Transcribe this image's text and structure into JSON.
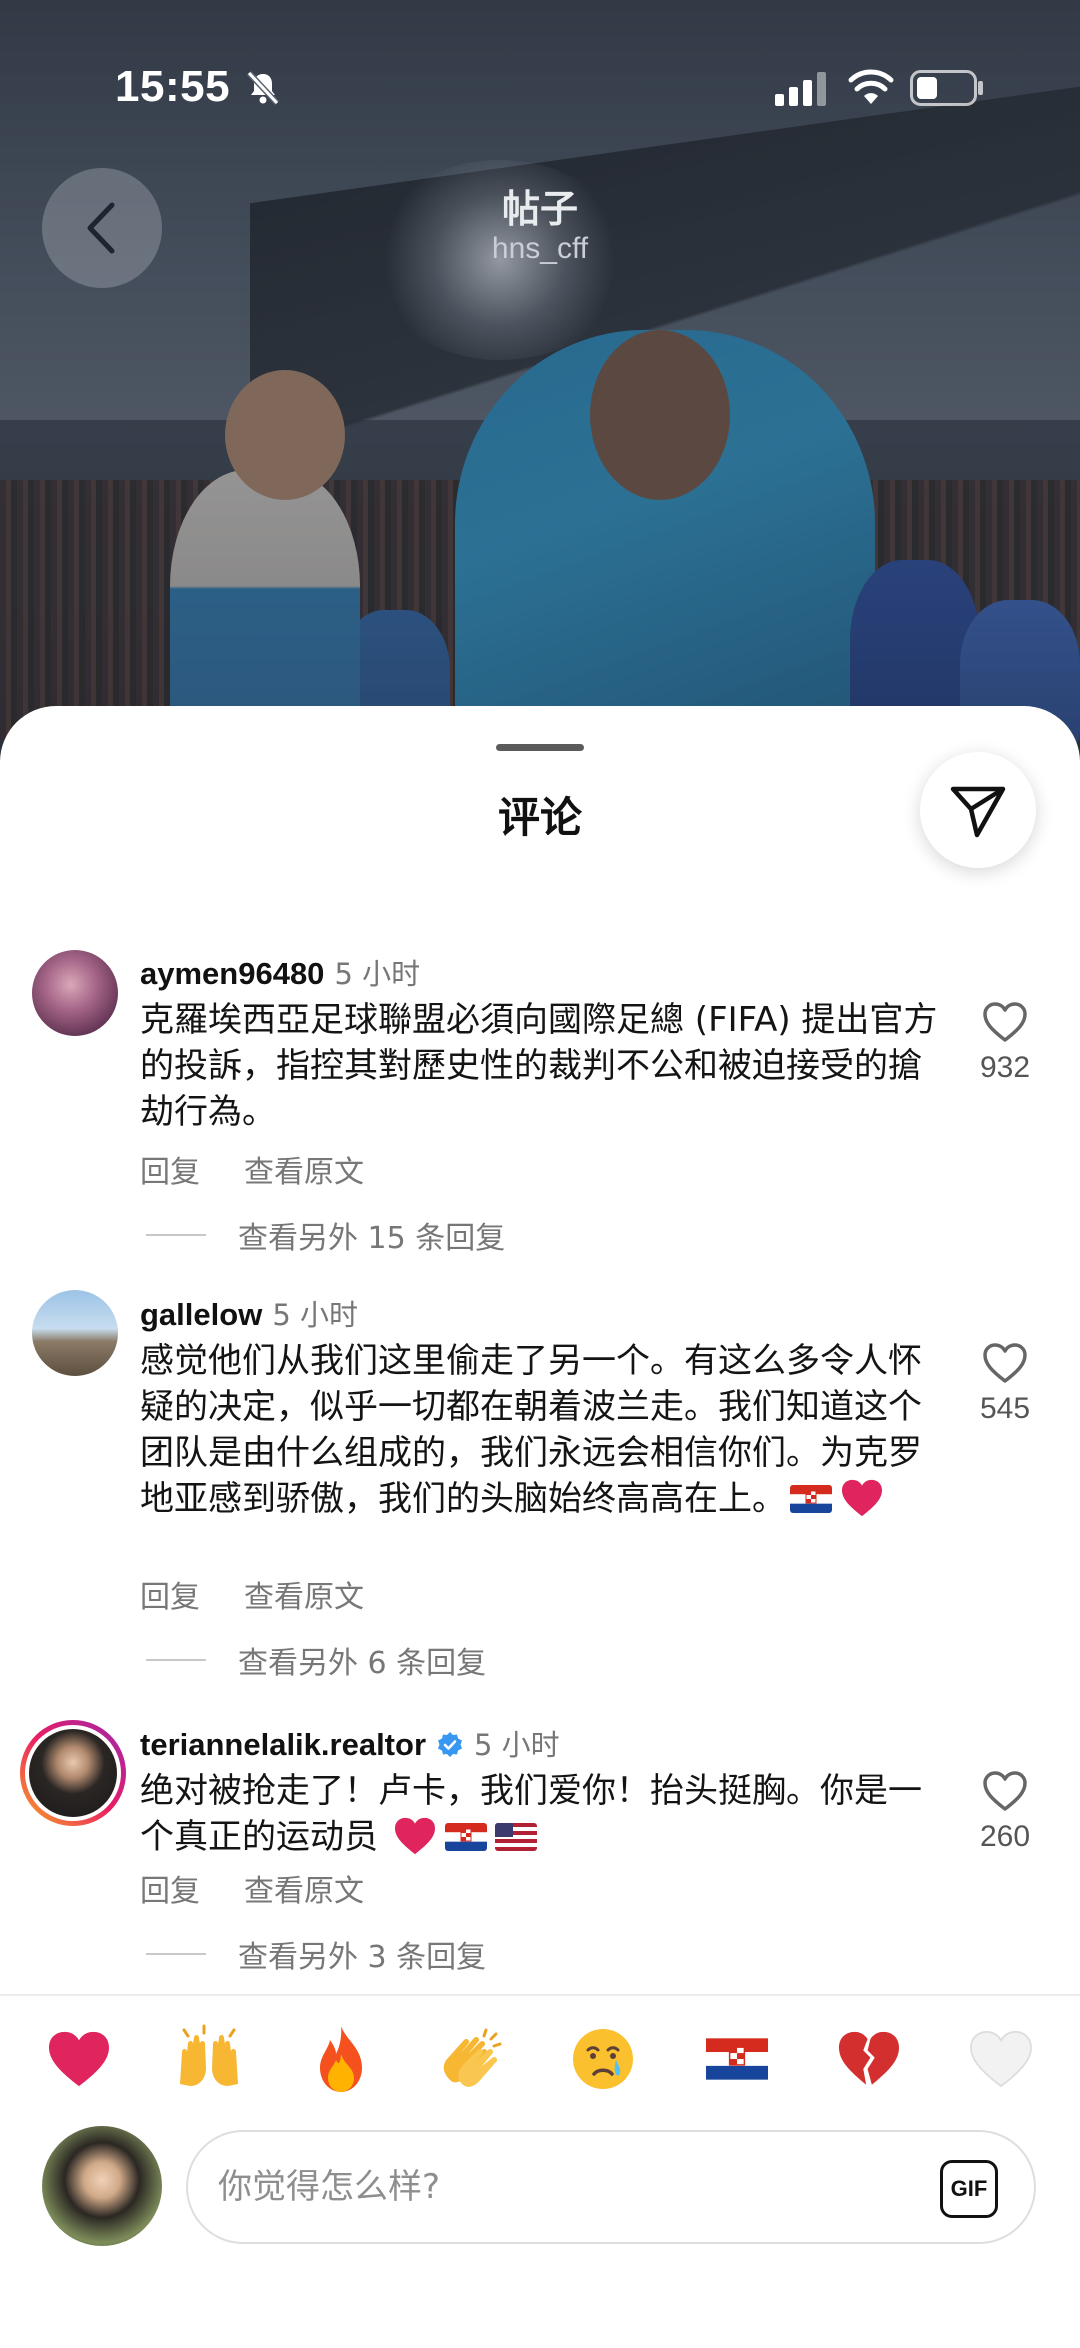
{
  "status_bar": {
    "time": "15:55"
  },
  "header": {
    "title": "帖子",
    "subtitle": "hns_cff"
  },
  "sheet": {
    "title": "评论"
  },
  "comments": [
    {
      "username": "aymen96480",
      "time": "5 小时",
      "text": "克羅埃西亞足球聯盟必須向國際足總 (FIFA) 提出官方的投訴，指控其對歷史性的裁判不公和被迫接受的搶劫行為。",
      "reply_label": "回复",
      "view_original_label": "查看原文",
      "more_replies": "查看另外 15 条回复",
      "likes": "932"
    },
    {
      "username": "gallelow",
      "time": "5 小时",
      "text": "感觉他们从我们这里偷走了另一个。有这么多令人怀疑的决定，似乎一切都在朝着波兰走。我们知道这个团队是由什么组成的，我们永远会相信你们。为克罗地亚感到骄傲，我们的头脑始终高高在上。",
      "emojis": [
        "croatia-flag",
        "red-heart"
      ],
      "reply_label": "回复",
      "view_original_label": "查看原文",
      "more_replies": "查看另外 6 条回复",
      "likes": "545"
    },
    {
      "username": "teriannelalik.realtor",
      "verified": true,
      "time": "5 小时",
      "text": "绝对被抢走了！卢卡，我们爱你！抬头挺胸。你是一个真正的运动员",
      "emojis": [
        "red-heart",
        "croatia-flag",
        "usa-flag"
      ],
      "reply_label": "回复",
      "view_original_label": "查看原文",
      "more_replies": "查看另外 3 条回复",
      "likes": "260"
    }
  ],
  "reactions": [
    "red-heart",
    "raising-hands",
    "fire",
    "clapping-hands",
    "crying-face",
    "croatia-flag",
    "broken-heart",
    "white-heart"
  ],
  "composer": {
    "placeholder": "你觉得怎么样?",
    "gif_label": "GIF"
  },
  "colors": {
    "accent_blue": "#3897f0",
    "heart_red": "#e0245e",
    "muted_text": "#777777"
  }
}
